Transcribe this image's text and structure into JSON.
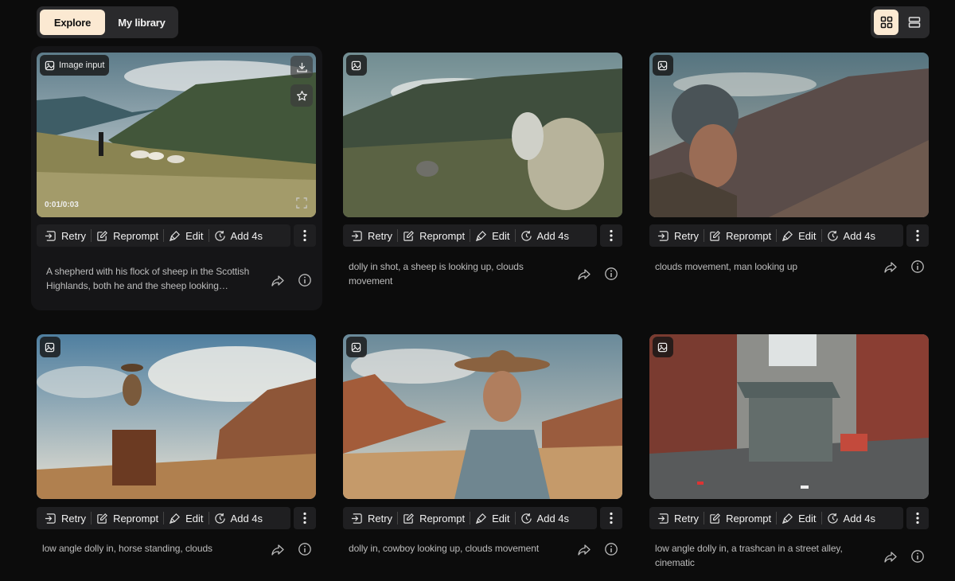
{
  "tabs": {
    "explore": "Explore",
    "library": "My library"
  },
  "view_toggle": [
    "grid-view",
    "list-view"
  ],
  "actions": {
    "retry": "Retry",
    "reprompt": "Reprompt",
    "edit": "Edit",
    "add": "Add 4s"
  },
  "cards": [
    {
      "caption": "A shepherd with his flock of sheep in the Scottish Highlands, both he and the sheep looking…",
      "badge_label": "Image input",
      "time": "0:01/0:03"
    },
    {
      "caption": "dolly in shot, a sheep is looking up, clouds movement"
    },
    {
      "caption": "clouds movement, man looking up"
    },
    {
      "caption": "low angle dolly in, horse standing, clouds"
    },
    {
      "caption": "dolly in, cowboy looking up, clouds movement"
    },
    {
      "caption": "low angle dolly in, a trashcan in a street alley, cinematic"
    }
  ],
  "colors": {
    "accent": "#fbe9d2",
    "background": "#0c0c0c",
    "panel": "#2a2a2c"
  }
}
